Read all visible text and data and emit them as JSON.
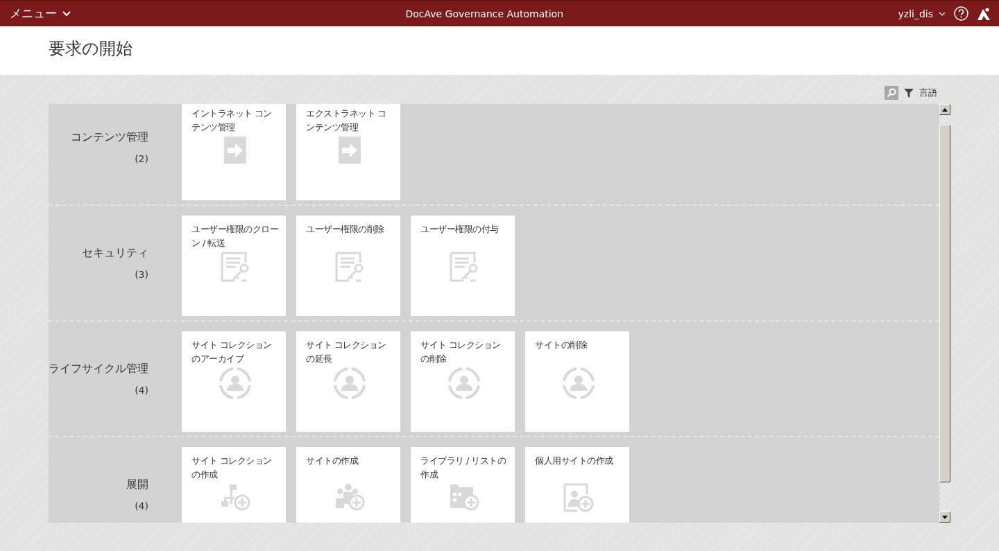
{
  "header": {
    "menu_label": "メニュー",
    "app_title": "DocAve Governance Automation",
    "user": "yzli_dis"
  },
  "page_title": "要求の開始",
  "toolbar": {
    "language_label": "言語"
  },
  "categories": [
    {
      "name": "コンテンツ管理",
      "count": "(2)",
      "tiles": [
        {
          "label": "イントラネット コンテンツ管理",
          "kind": "arrow"
        },
        {
          "label": "エクストラネット コンテンツ管理",
          "kind": "arrow"
        }
      ]
    },
    {
      "name": "セキュリティ",
      "count": "(3)",
      "tiles": [
        {
          "label": "ユーザー権限のクローン / 転送",
          "kind": "key"
        },
        {
          "label": "ユーザー権限の削除",
          "kind": "key"
        },
        {
          "label": "ユーザー権限の付与",
          "kind": "key"
        }
      ]
    },
    {
      "name": "ライフサイクル管理",
      "count": "(4)",
      "tiles": [
        {
          "label": "サイト コレクションのアーカイブ",
          "kind": "target"
        },
        {
          "label": "サイト コレクションの延長",
          "kind": "target"
        },
        {
          "label": "サイト コレクションの削除",
          "kind": "target"
        },
        {
          "label": "サイトの削除",
          "kind": "target"
        }
      ]
    },
    {
      "name": "展開",
      "count": "(4)",
      "tiles": [
        {
          "label": "サイト コレクションの作成",
          "kind": "chart"
        },
        {
          "label": "サイトの作成",
          "kind": "group"
        },
        {
          "label": "ライブラリ / リストの作成",
          "kind": "folder"
        },
        {
          "label": "個人用サイトの作成",
          "kind": "profile"
        }
      ]
    }
  ]
}
